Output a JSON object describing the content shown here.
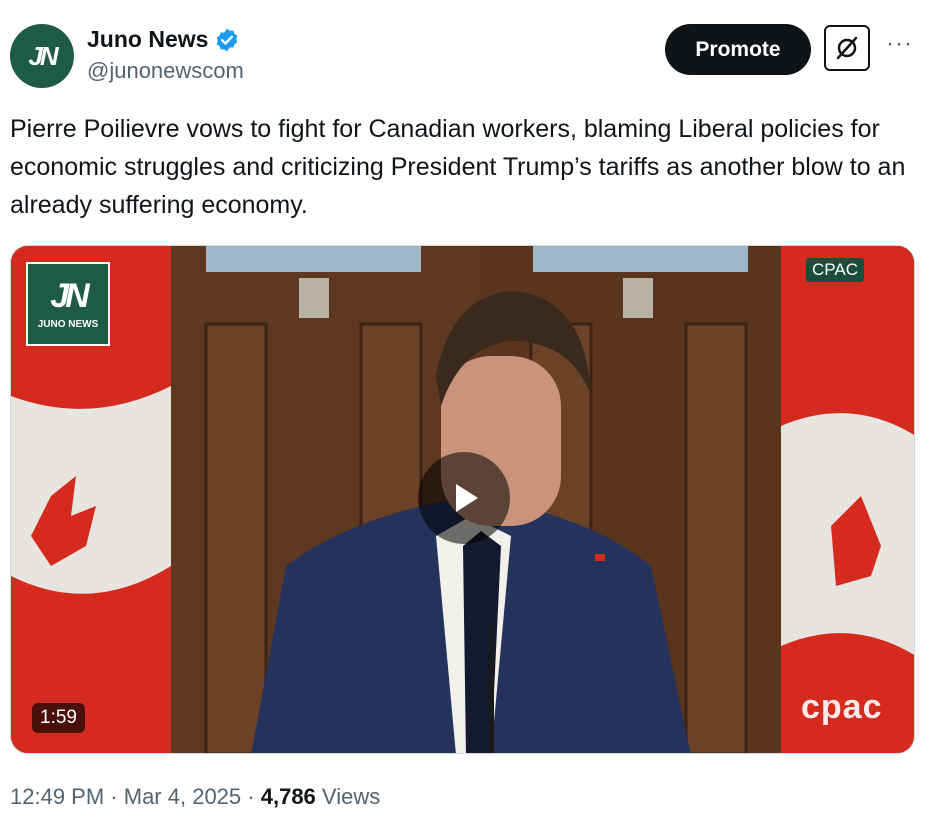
{
  "account": {
    "avatar_text": "JN",
    "name": "Juno News",
    "handle": "@junonewscom"
  },
  "actions": {
    "promote_label": "Promote",
    "more_label": "···"
  },
  "tweet": {
    "text": "Pierre Poilievre vows to fight for Canadian workers, blaming Liberal policies for economic struggles and criticizing President Trump’s tariffs as another blow to an already suffering economy."
  },
  "video": {
    "badge_mark": "JN",
    "badge_text": "JUNO NEWS",
    "network_top": "CPAC",
    "network_bottom": "cpac",
    "duration": "1:59"
  },
  "meta": {
    "time": "12:49 PM",
    "sep1": "·",
    "date": "Mar 4, 2025",
    "sep2": "·",
    "views_count": "4,786",
    "views_label": "Views"
  },
  "colors": {
    "brand_green": "#1f5a45",
    "verified_blue": "#1d9bf0",
    "text_primary": "#0f1419",
    "text_secondary": "#536471",
    "flag_red": "#d52b1e"
  }
}
